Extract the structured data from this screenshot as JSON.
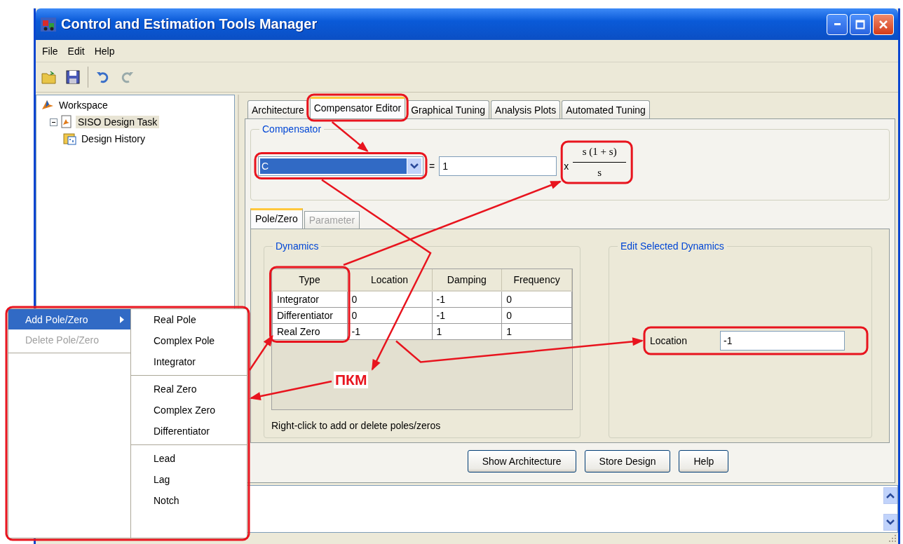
{
  "window": {
    "title": "Control and Estimation Tools Manager"
  },
  "menu": [
    "File",
    "Edit",
    "Help"
  ],
  "tree": [
    {
      "label": "Workspace",
      "kind": "workspace",
      "selected": false,
      "children": [
        {
          "label": "SISO Design Task",
          "kind": "task",
          "selected": true,
          "expanded": true,
          "children": [
            {
              "label": "Design History",
              "kind": "history",
              "selected": false
            }
          ]
        }
      ]
    }
  ],
  "tabs": [
    {
      "label": "Architecture",
      "selected": false
    },
    {
      "label": "Compensator Editor",
      "selected": true
    },
    {
      "label": "Graphical Tuning",
      "selected": false
    },
    {
      "label": "Analysis Plots",
      "selected": false
    },
    {
      "label": "Automated Tuning",
      "selected": false
    }
  ],
  "compensator": {
    "title": "Compensator",
    "name": "C",
    "equals": "=",
    "gain": "1",
    "times": "x",
    "numerator": "s (1 + s)",
    "denominator": "s"
  },
  "subtabs": [
    {
      "label": "Pole/Zero",
      "selected": true,
      "disabled": false
    },
    {
      "label": "Parameter",
      "selected": false,
      "disabled": true
    }
  ],
  "dynamics": {
    "title": "Dynamics",
    "columns": [
      "Type",
      "Location",
      "Damping",
      "Frequency"
    ],
    "rows": [
      [
        "Integrator",
        "0",
        "-1",
        "0"
      ],
      [
        "Differentiator",
        "0",
        "-1",
        "0"
      ],
      [
        "Real Zero",
        "-1",
        "1",
        "1"
      ]
    ],
    "hint": "Right-click to add or delete poles/zeros"
  },
  "edit_selected": {
    "title": "Edit Selected Dynamics",
    "fields": [
      {
        "label": "Location",
        "value": "-1"
      }
    ]
  },
  "buttons": [
    "Show Architecture",
    "Store Design",
    "Help"
  ],
  "context_menu": {
    "items": [
      {
        "label": "Add Pole/Zero",
        "selected": true,
        "disabled": false,
        "submenu": true
      },
      {
        "label": "Delete Pole/Zero",
        "selected": false,
        "disabled": true,
        "submenu": false
      }
    ],
    "submenu": [
      [
        "Real Pole",
        "Complex Pole",
        "Integrator"
      ],
      [
        "Real Zero",
        "Complex Zero",
        "Differentiator"
      ],
      [
        "Lead",
        "Lag",
        "Notch"
      ]
    ]
  },
  "annotation": {
    "label": "ПКМ"
  }
}
